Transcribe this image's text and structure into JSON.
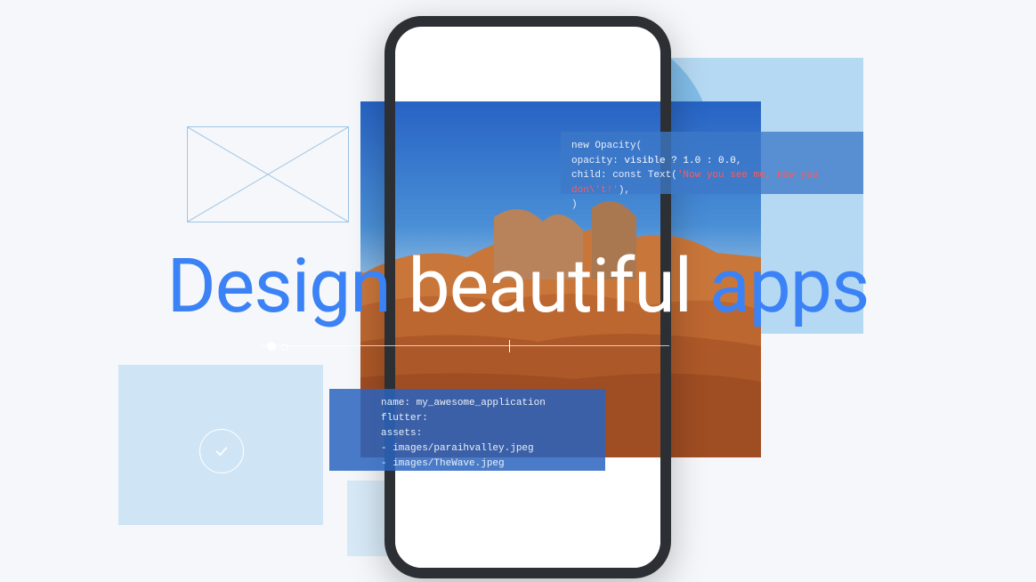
{
  "headline": {
    "w1": "Design",
    "w2": "beautiful",
    "w3": "apps"
  },
  "code_top": {
    "l1": "new Opacity(",
    "l2a": "  opacity: ",
    "l2b": "visible ? 1.0 : 0.0",
    "l2c": ",",
    "l3a": "  child: const Text(",
    "l3b": "'Now you see me, now you don\\'t!'",
    "l3c": "),",
    "l4": ")"
  },
  "code_bot": {
    "l1": "name: my_awesome_application",
    "l2": "flutter:",
    "l3": "  assets:",
    "l4": "    - images/paraihvalley.jpeg",
    "l5": "    - images/TheWave.jpeg"
  }
}
